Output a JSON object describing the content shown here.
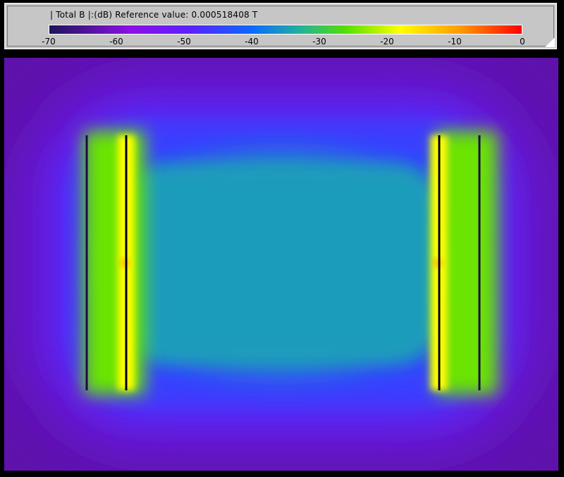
{
  "chart_data": {
    "type": "heatmap",
    "title": "| Total B |:(dB) Reference value: 0.000518408 T",
    "quantity": "| Total B |",
    "unit": "dB",
    "reference_value": "0.000518408 T",
    "colorbar": {
      "min": -70,
      "max": 0,
      "ticks": [
        -70,
        -60,
        -50,
        -40,
        -30,
        -20,
        -10,
        0
      ],
      "tick_labels": [
        "-70",
        "-60",
        "-50",
        "-40",
        "-30",
        "-20",
        "-10",
        "0"
      ],
      "colormap": [
        {
          "value": -70,
          "color": "#1e1459"
        },
        {
          "value": -58,
          "color": "#8c10e6"
        },
        {
          "value": -49,
          "color": "#5a22ff"
        },
        {
          "value": -40,
          "color": "#0a6aff"
        },
        {
          "value": -33,
          "color": "#20b0a0"
        },
        {
          "value": -26,
          "color": "#55e000"
        },
        {
          "value": -18,
          "color": "#ffff00"
        },
        {
          "value": -9,
          "color": "#ff9900"
        },
        {
          "value": 0,
          "color": "#ff0000"
        }
      ]
    },
    "field_regions": [
      {
        "region": "corner",
        "value": -63
      },
      {
        "region": "outer",
        "value": -52
      },
      {
        "region": "top-bottom",
        "value": -45
      },
      {
        "region": "center",
        "value": -35
      },
      {
        "region": "near-conductor",
        "value": -25
      },
      {
        "region": "conductor-edge",
        "value": -18
      },
      {
        "region": "hotspot",
        "value": -8
      }
    ],
    "conductors": 4
  }
}
